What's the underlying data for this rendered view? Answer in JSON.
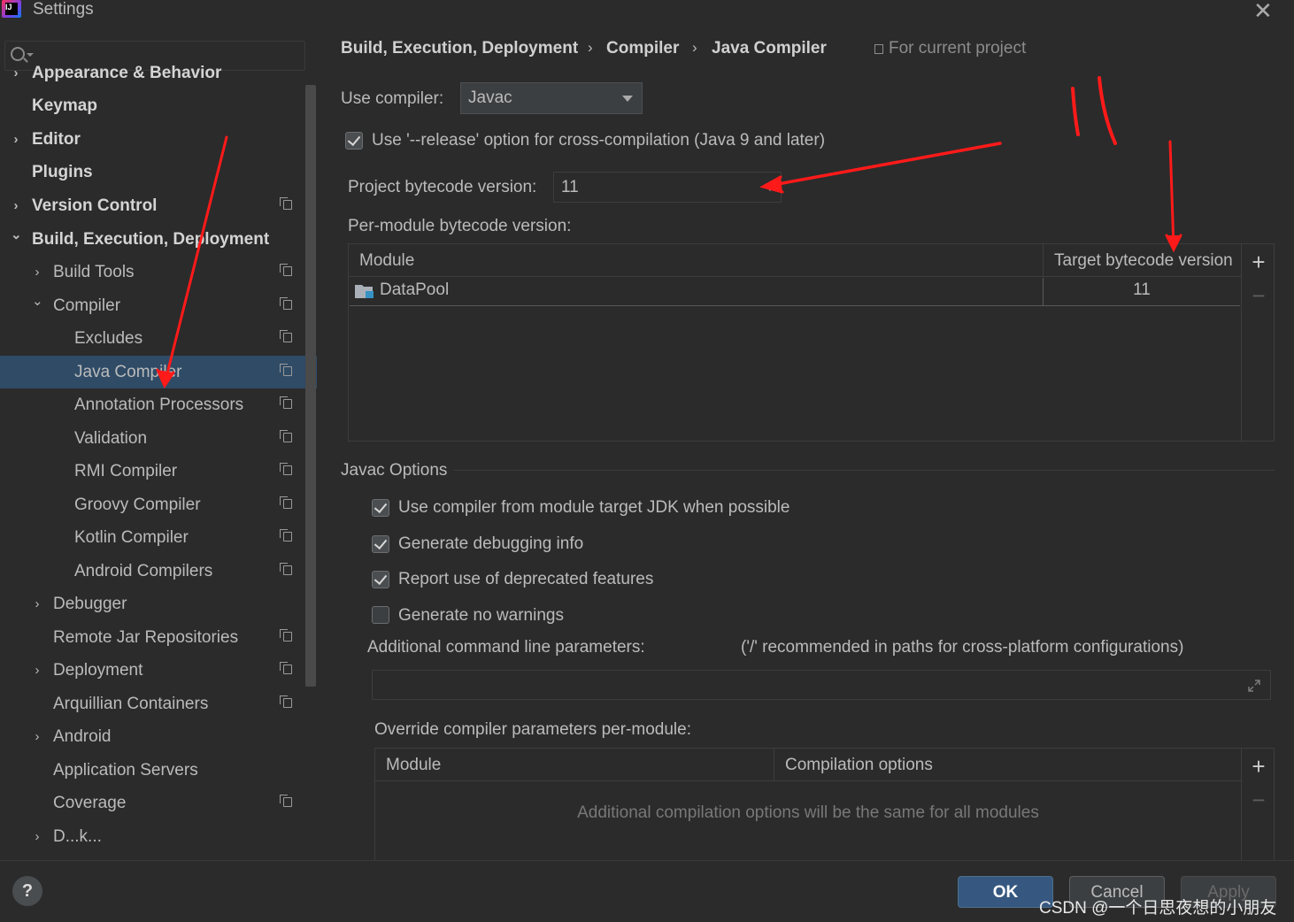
{
  "window": {
    "title": "Settings",
    "close_glyph": "✕"
  },
  "sidebar": {
    "search_placeholder": "",
    "items": [
      {
        "label": "Appearance & Behavior",
        "arrow": "›",
        "project": false
      },
      {
        "label": "Keymap",
        "arrow": "",
        "project": false
      },
      {
        "label": "Editor",
        "arrow": "›",
        "project": false
      },
      {
        "label": "Plugins",
        "arrow": "",
        "project": false
      },
      {
        "label": "Version Control",
        "arrow": "›",
        "project": true
      },
      {
        "label": "Build, Execution, Deployment",
        "arrow": "⌄",
        "project": false
      },
      {
        "label": "Build Tools",
        "arrow": "›",
        "project": true
      },
      {
        "label": "Compiler",
        "arrow": "⌄",
        "project": true
      },
      {
        "label": "Excludes",
        "arrow": "",
        "project": true
      },
      {
        "label": "Java Compiler",
        "arrow": "",
        "project": true
      },
      {
        "label": "Annotation Processors",
        "arrow": "",
        "project": true
      },
      {
        "label": "Validation",
        "arrow": "",
        "project": true
      },
      {
        "label": "RMI Compiler",
        "arrow": "",
        "project": true
      },
      {
        "label": "Groovy Compiler",
        "arrow": "",
        "project": true
      },
      {
        "label": "Kotlin Compiler",
        "arrow": "",
        "project": true
      },
      {
        "label": "Android Compilers",
        "arrow": "",
        "project": true
      },
      {
        "label": "Debugger",
        "arrow": "›",
        "project": false
      },
      {
        "label": "Remote Jar Repositories",
        "arrow": "",
        "project": true
      },
      {
        "label": "Deployment",
        "arrow": "›",
        "project": true
      },
      {
        "label": "Arquillian Containers",
        "arrow": "",
        "project": true
      },
      {
        "label": "Android",
        "arrow": "›",
        "project": false
      },
      {
        "label": "Application Servers",
        "arrow": "",
        "project": false
      },
      {
        "label": "Coverage",
        "arrow": "",
        "project": true
      },
      {
        "label": "D...k...",
        "arrow": "›",
        "project": false
      }
    ]
  },
  "breadcrumb": {
    "parts": [
      "Build, Execution, Deployment",
      "Compiler",
      "Java Compiler"
    ],
    "separator": "›",
    "scope": "For current project"
  },
  "compiler": {
    "use_compiler_label": "Use compiler:",
    "use_compiler_value": "Javac",
    "release_option_label": "Use '--release' option for cross-compilation (Java 9 and later)",
    "release_option_checked": true,
    "project_bytecode_label": "Project bytecode version:",
    "project_bytecode_value": "11",
    "per_module_label": "Per-module bytecode version:",
    "module_table": {
      "columns": [
        "Module",
        "Target bytecode version"
      ],
      "rows": [
        {
          "module": "DataPool",
          "version": "11"
        }
      ]
    }
  },
  "javac_options": {
    "section_title": "Javac Options",
    "checkboxes": [
      {
        "label": "Use compiler from module target JDK when possible",
        "checked": true
      },
      {
        "label": "Generate debugging info",
        "checked": true
      },
      {
        "label": "Report use of deprecated features",
        "checked": true
      },
      {
        "label": "Generate no warnings",
        "checked": false
      }
    ],
    "additional_params_label": "Additional command line parameters:",
    "additional_params_hint": "('/' recommended in paths for cross-platform configurations)",
    "additional_params_value": "",
    "override_label": "Override compiler parameters per-module:",
    "override_table": {
      "columns": [
        "Module",
        "Compilation options"
      ],
      "empty_text": "Additional compilation options will be the same for all modules"
    }
  },
  "footer": {
    "help_label": "?",
    "ok_label": "OK",
    "cancel_label": "Cancel",
    "apply_label": "Apply",
    "watermark": "CSDN @一个日思夜想的小朋友"
  },
  "colors": {
    "background": "#2b2b2b",
    "selection": "#2f4b66",
    "ok_button": "#365880",
    "annotation": "#ff1a1a"
  }
}
